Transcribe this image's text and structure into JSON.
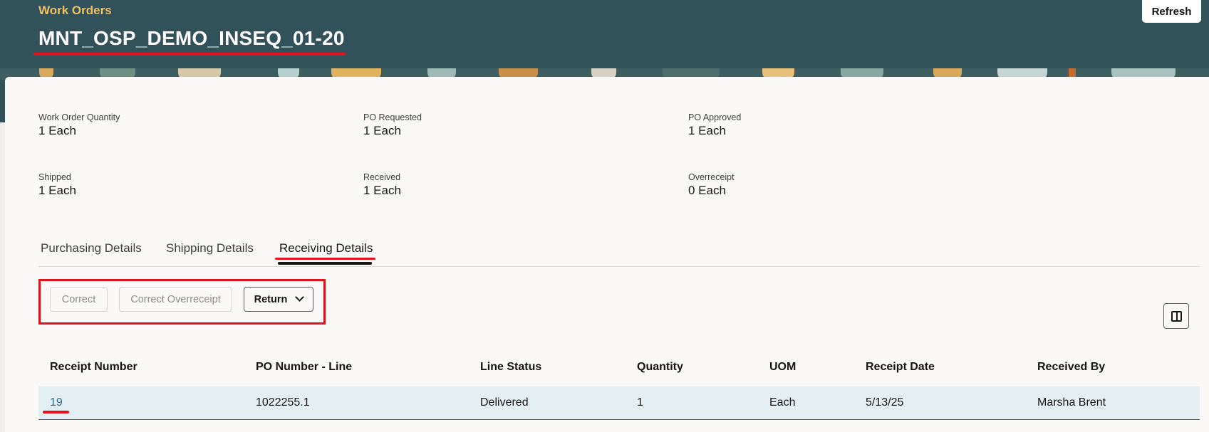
{
  "header": {
    "breadcrumb": "Work Orders",
    "title": "MNT_OSP_DEMO_INSEQ_01-20",
    "refresh_label": "Refresh"
  },
  "metrics": [
    {
      "label": "Work Order Quantity",
      "value": "1 Each"
    },
    {
      "label": "PO Requested",
      "value": "1 Each"
    },
    {
      "label": "PO Approved",
      "value": "1 Each"
    },
    {
      "label": "Shipped",
      "value": "1 Each"
    },
    {
      "label": "Received",
      "value": "1 Each"
    },
    {
      "label": "Overreceipt",
      "value": "0 Each"
    }
  ],
  "tabs": [
    {
      "label": "Purchasing Details",
      "active": false
    },
    {
      "label": "Shipping Details",
      "active": false
    },
    {
      "label": "Receiving Details",
      "active": true
    }
  ],
  "toolbar": {
    "correct_label": "Correct",
    "correct_overreceipt_label": "Correct Overreceipt",
    "return_label": "Return",
    "columns_icon": "columns-icon"
  },
  "table": {
    "headers": [
      "Receipt Number",
      "PO Number - Line",
      "Line Status",
      "Quantity",
      "UOM",
      "Receipt Date",
      "Received By"
    ],
    "rows": [
      [
        "19",
        "1022255.1",
        "Delivered",
        "1",
        "Each",
        "5/13/25",
        "Marsha Brent"
      ]
    ]
  },
  "colors": {
    "header_bg": "#31525a",
    "accent_gold": "#f0c162",
    "highlight_red": "#e0121e",
    "link": "#2a6b86",
    "selected_row": "#e4eff3"
  }
}
